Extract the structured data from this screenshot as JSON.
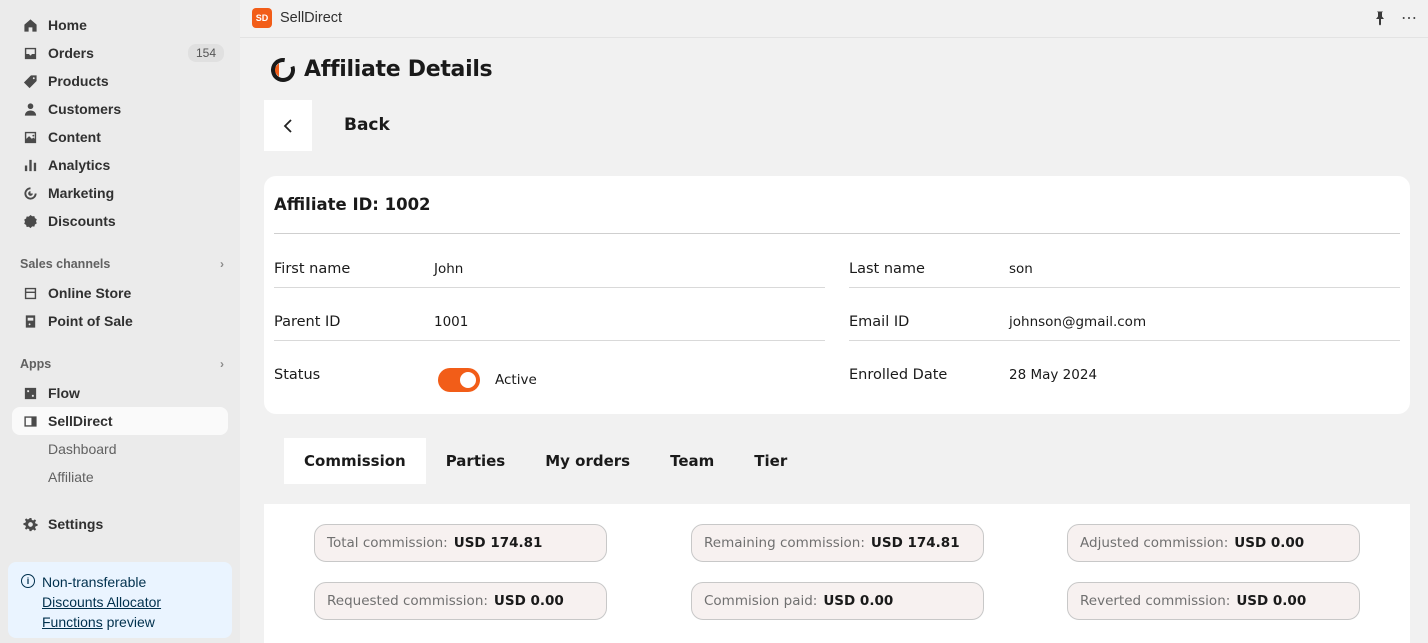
{
  "sidebar": {
    "items": [
      {
        "label": "Home",
        "icon": "home-icon"
      },
      {
        "label": "Orders",
        "icon": "inbox-icon",
        "badge": "154"
      },
      {
        "label": "Products",
        "icon": "tag-icon"
      },
      {
        "label": "Customers",
        "icon": "person-icon"
      },
      {
        "label": "Content",
        "icon": "image-icon"
      },
      {
        "label": "Analytics",
        "icon": "bar-chart-icon"
      },
      {
        "label": "Marketing",
        "icon": "target-icon"
      },
      {
        "label": "Discounts",
        "icon": "discount-icon"
      }
    ],
    "sales_channels_label": "Sales channels",
    "channels": [
      {
        "label": "Online Store",
        "icon": "store-icon"
      },
      {
        "label": "Point of Sale",
        "icon": "pos-icon"
      }
    ],
    "apps_label": "Apps",
    "apps": [
      {
        "label": "Flow",
        "icon": "flow-icon"
      },
      {
        "label": "SellDirect",
        "icon": "app-icon"
      }
    ],
    "subitems": [
      "Dashboard",
      "Affiliate"
    ],
    "settings_label": "Settings",
    "notice": {
      "line1": "Non-transferable",
      "link1": "Discounts Allocator",
      "link2": "Functions",
      "suffix": " preview"
    }
  },
  "topbar": {
    "app_logo": "SD",
    "app_title": "SellDirect"
  },
  "page": {
    "title": "Affiliate Details",
    "back_label": "Back"
  },
  "affiliate": {
    "title": "Affiliate ID: 1002",
    "first_name_label": "First name",
    "first_name": "John",
    "last_name_label": "Last name",
    "last_name": "son",
    "parent_id_label": "Parent ID",
    "parent_id": "1001",
    "email_label": "Email ID",
    "email": "johnson@gmail.com",
    "status_label": "Status",
    "status": "Active",
    "status_on": true,
    "enrolled_label": "Enrolled Date",
    "enrolled": "28 May 2024"
  },
  "tabs": [
    "Commission",
    "Parties",
    "My orders",
    "Team",
    "Tier"
  ],
  "commission": {
    "total_label": "Total commission:",
    "total": "USD 174.81",
    "remaining_label": "Remaining commission:",
    "remaining": "USD 174.81",
    "adjusted_label": "Adjusted commission:",
    "adjusted": "USD 0.00",
    "requested_label": "Requested commission:",
    "requested": "USD 0.00",
    "paid_label": "Commision paid:",
    "paid": "USD 0.00",
    "reverted_label": "Reverted commission:",
    "reverted": "USD 0.00"
  },
  "colors": {
    "accent": "#f25d18",
    "background": "#f1f1f1",
    "sidebar": "#ebebeb",
    "notice_bg": "#eaf4ff"
  }
}
